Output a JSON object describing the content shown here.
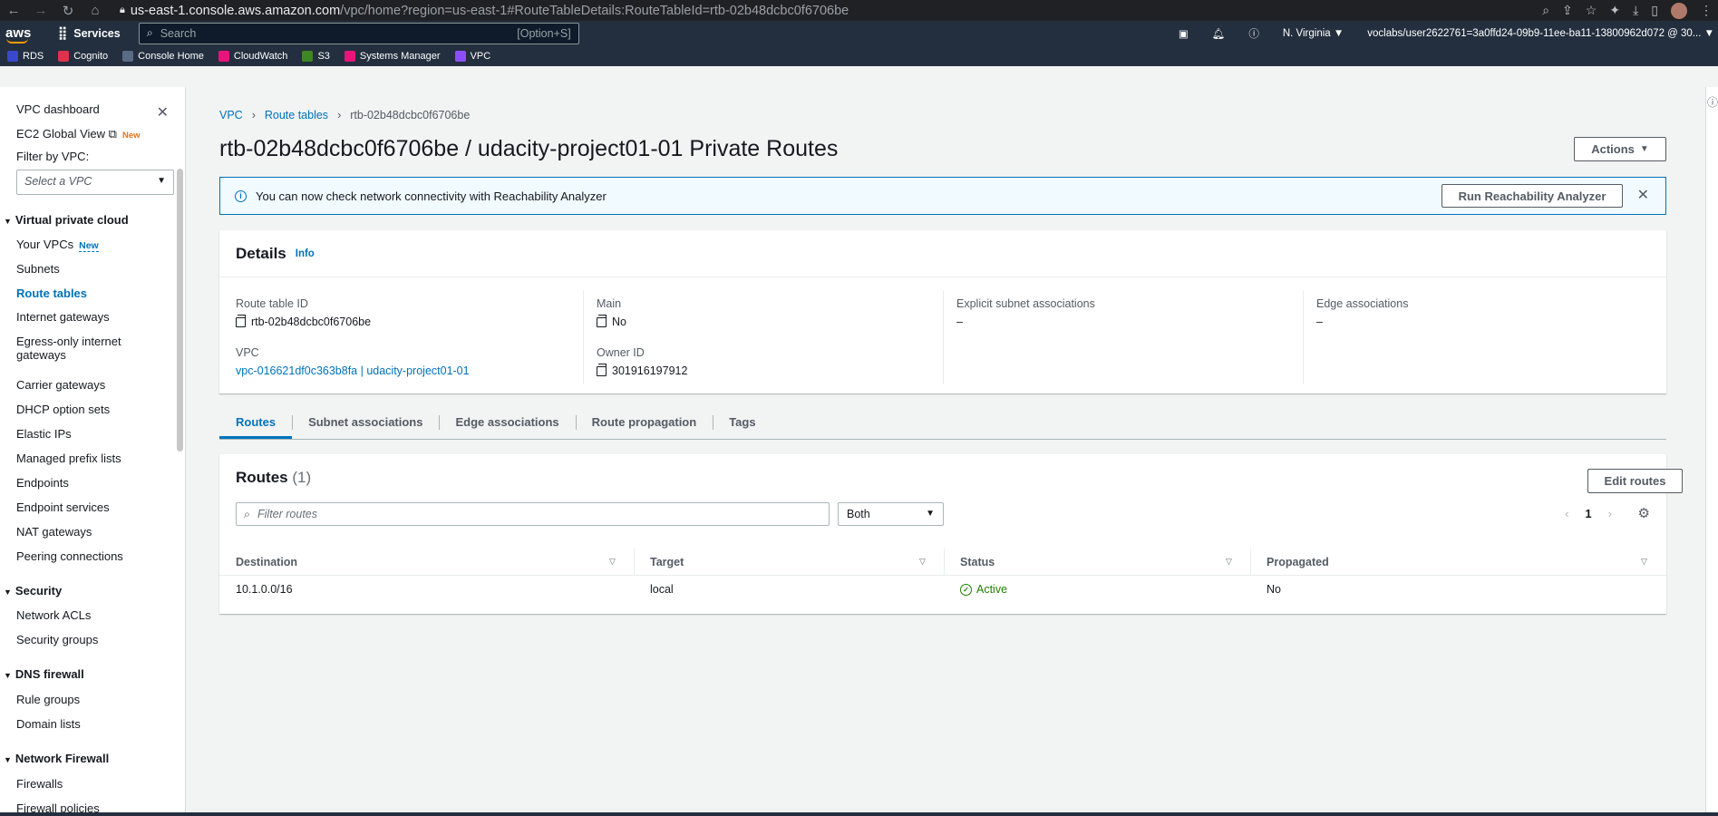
{
  "browser": {
    "url_host": "us-east-1.console.aws.amazon.com",
    "url_path": "/vpc/home?region=us-east-1#RouteTableDetails:RouteTableId=rtb-02b48dcbc0f6706be"
  },
  "aws_nav": {
    "logo": "aws",
    "services_label": "Services",
    "search_placeholder": "Search",
    "search_shortcut": "[Option+S]",
    "region": "N. Virginia ▼",
    "account": "voclabs/user2622761=3a0ffd24-09b9-11ee-ba11-13800962d072 @ 30... ▼",
    "favorites": [
      {
        "label": "RDS",
        "color": "#3b48cc"
      },
      {
        "label": "Cognito",
        "color": "#dd344c"
      },
      {
        "label": "Console Home",
        "color": "#5a6b86"
      },
      {
        "label": "CloudWatch",
        "color": "#e7157b"
      },
      {
        "label": "S3",
        "color": "#3f8624"
      },
      {
        "label": "Systems Manager",
        "color": "#e7157b"
      },
      {
        "label": "VPC",
        "color": "#8c4fff"
      }
    ]
  },
  "sidebar": {
    "dashboard": "VPC dashboard",
    "global_view": "EC2 Global View",
    "new_badge": "New",
    "filter_label": "Filter by VPC:",
    "filter_placeholder": "Select a VPC",
    "sections": {
      "vpc": "Virtual private cloud",
      "security": "Security",
      "dns": "DNS firewall",
      "network_firewall": "Network Firewall"
    },
    "items": {
      "your_vpcs": "Your VPCs",
      "subnets": "Subnets",
      "route_tables": "Route tables",
      "internet_gateways": "Internet gateways",
      "egress_1": "Egress-only internet",
      "egress_2": "gateways",
      "carrier": "Carrier gateways",
      "dhcp": "DHCP option sets",
      "eips": "Elastic IPs",
      "prefix": "Managed prefix lists",
      "endpoints": "Endpoints",
      "endpoint_services": "Endpoint services",
      "nat": "NAT gateways",
      "peering": "Peering connections",
      "nacls": "Network ACLs",
      "sgs": "Security groups",
      "rule_groups": "Rule groups",
      "domain_lists": "Domain lists",
      "firewalls": "Firewalls",
      "firewall_policies": "Firewall policies"
    }
  },
  "breadcrumb": [
    "VPC",
    "Route tables",
    "rtb-02b48dcbc0f6706be"
  ],
  "page": {
    "title": "rtb-02b48dcbc0f6706be / udacity-project01-01 Private Routes",
    "actions_label": "Actions"
  },
  "banner": {
    "text": "You can now check network connectivity with Reachability Analyzer",
    "button": "Run Reachability Analyzer"
  },
  "details": {
    "title": "Details",
    "info": "Info",
    "route_table_id_label": "Route table ID",
    "route_table_id": "rtb-02b48dcbc0f6706be",
    "vpc_label": "VPC",
    "vpc_value": "vpc-016621df0c363b8fa | udacity-project01-01",
    "main_label": "Main",
    "main_value": "No",
    "owner_label": "Owner ID",
    "owner_value": "301916197912",
    "explicit_label": "Explicit subnet associations",
    "explicit_value": "–",
    "edge_label": "Edge associations",
    "edge_value": "–"
  },
  "tabs": [
    "Routes",
    "Subnet associations",
    "Edge associations",
    "Route propagation",
    "Tags"
  ],
  "routes": {
    "title": "Routes",
    "count": "(1)",
    "edit_label": "Edit routes",
    "filter_placeholder": "Filter routes",
    "select_value": "Both",
    "page": "1",
    "columns": [
      "Destination",
      "Target",
      "Status",
      "Propagated"
    ],
    "rows": [
      {
        "destination": "10.1.0.0/16",
        "target": "local",
        "status": "Active",
        "propagated": "No"
      }
    ]
  }
}
